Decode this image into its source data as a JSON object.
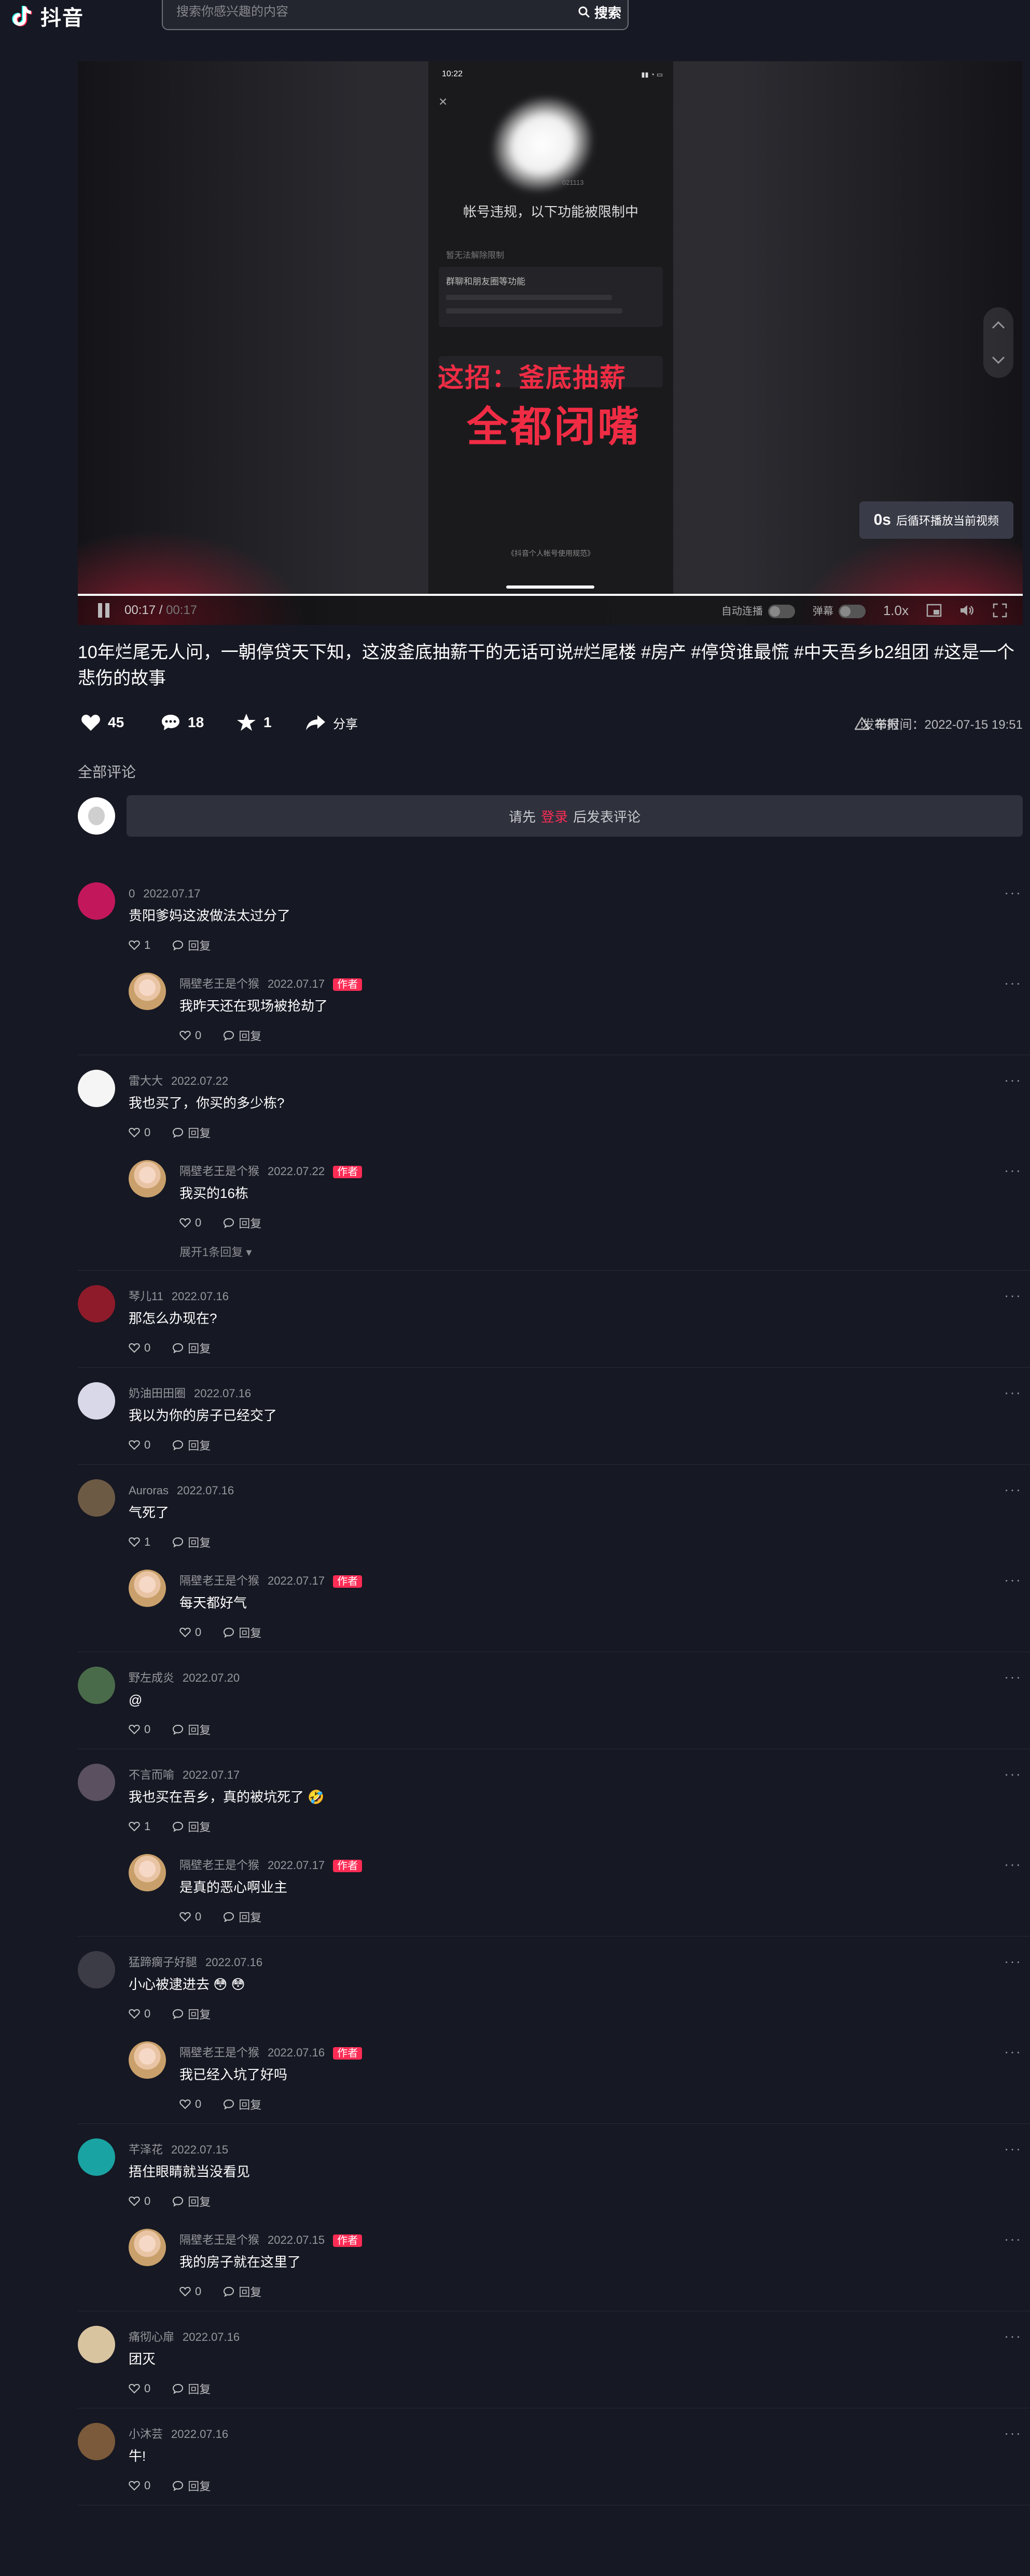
{
  "header": {
    "logo_text": "抖音",
    "search_placeholder": "搜索你感兴趣的内容",
    "search_button": "搜索"
  },
  "player": {
    "phone_time": "10:22",
    "phone_status": "▮▮ ◔ ▭",
    "account_id": "021113",
    "restriction_title": "帐号违规，以下功能被限制中",
    "restriction_subtitle": "暂无法解除限制",
    "card_title": "群聊和朋友圈等功能",
    "overlay_line1": "这招：釜底抽薪",
    "overlay_line2": "全都闭嘴",
    "phone_footer": "《抖音个人帐号使用规范》",
    "loop_seconds": "0s",
    "loop_text": "后循环播放当前视频",
    "current_time": "00:17",
    "duration": "00:17",
    "progress_fraction": 1.0,
    "autoplay_label": "自动连播",
    "danmaku_label": "弹幕",
    "speed": "1.0x"
  },
  "video": {
    "title": "10年烂尾无人问，一朝停贷天下知，这波釜底抽薪干的无话可说#烂尾楼 #房产 #停贷谁最慌 #中天吾乡b2组团 #这是一个悲伤的故事",
    "likes": "45",
    "comments": "18",
    "favorites": "1",
    "share_label": "分享",
    "report_label": "举报",
    "publish_time": "发布时间：2022-07-15 19:51"
  },
  "comments_section": {
    "heading": "全部评论",
    "prompt_before": "请先",
    "prompt_login": "登录",
    "prompt_after": "后发表评论",
    "reply_label": "回复",
    "author_tag": "作者",
    "expand_label": "展开1条回复",
    "threads": [
      {
        "user": "0",
        "date": "2022.07.17",
        "text": "贵阳爹妈这波做法太过分了",
        "likes": "1",
        "avatar_color": "#c2185b",
        "replies": [
          {
            "user": "隔壁老王是个猴",
            "date": "2022.07.17",
            "text": "我昨天还在现场被抢劫了",
            "likes": "0"
          }
        ]
      },
      {
        "user": "雷大大",
        "date": "2022.07.22",
        "text": "我也买了，你买的多少栋?",
        "likes": "0",
        "avatar_color": "#f5f5f5",
        "replies": [
          {
            "user": "隔壁老王是个猴",
            "date": "2022.07.22",
            "text": "我买的16栋",
            "likes": "0"
          }
        ],
        "expand": true
      },
      {
        "user": "琴儿11",
        "date": "2022.07.16",
        "text": "那怎么办现在?",
        "likes": "0",
        "avatar_color": "#8e1b2a",
        "replies": []
      },
      {
        "user": "奶油田田圈",
        "date": "2022.07.16",
        "text": "我以为你的房子已经交了",
        "likes": "0",
        "avatar_color": "#d8d8e8",
        "replies": []
      },
      {
        "user": "Auroras",
        "date": "2022.07.16",
        "text": "气死了",
        "likes": "1",
        "avatar_color": "#6d5a44",
        "replies": [
          {
            "user": "隔壁老王是个猴",
            "date": "2022.07.17",
            "text": "每天都好气",
            "likes": "0"
          }
        ]
      },
      {
        "user": "野左成炎",
        "date": "2022.07.20",
        "text": "@",
        "likes": "0",
        "avatar_color": "#4a6b4a",
        "replies": []
      },
      {
        "user": "不言而喻",
        "date": "2022.07.17",
        "text": "我也买在吾乡，真的被坑死了 🤣",
        "likes": "1",
        "avatar_color": "#5a5060",
        "replies": [
          {
            "user": "隔壁老王是个猴",
            "date": "2022.07.17",
            "text": "是真的恶心啊业主",
            "likes": "0"
          }
        ]
      },
      {
        "user": "猛蹄瘸子好腿",
        "date": "2022.07.16",
        "text": "小心被逮进去 😳 😳",
        "likes": "0",
        "avatar_color": "#3c3c46",
        "replies": [
          {
            "user": "隔壁老王是个猴",
            "date": "2022.07.16",
            "text": "我已经入坑了好吗",
            "likes": "0"
          }
        ]
      },
      {
        "user": "芊泽花",
        "date": "2022.07.15",
        "text": "捂住眼睛就当没看见",
        "likes": "0",
        "avatar_color": "#1aa3a3",
        "replies": [
          {
            "user": "隔壁老王是个猴",
            "date": "2022.07.15",
            "text": "我的房子就在这里了",
            "likes": "0"
          }
        ]
      },
      {
        "user": "痛彻心扉",
        "date": "2022.07.16",
        "text": "团灭",
        "likes": "0",
        "avatar_color": "#d9c4a0",
        "replies": []
      },
      {
        "user": "小沐芸",
        "date": "2022.07.16",
        "text": "牛!",
        "likes": "0",
        "avatar_color": "#7a5a3a",
        "replies": []
      }
    ]
  }
}
